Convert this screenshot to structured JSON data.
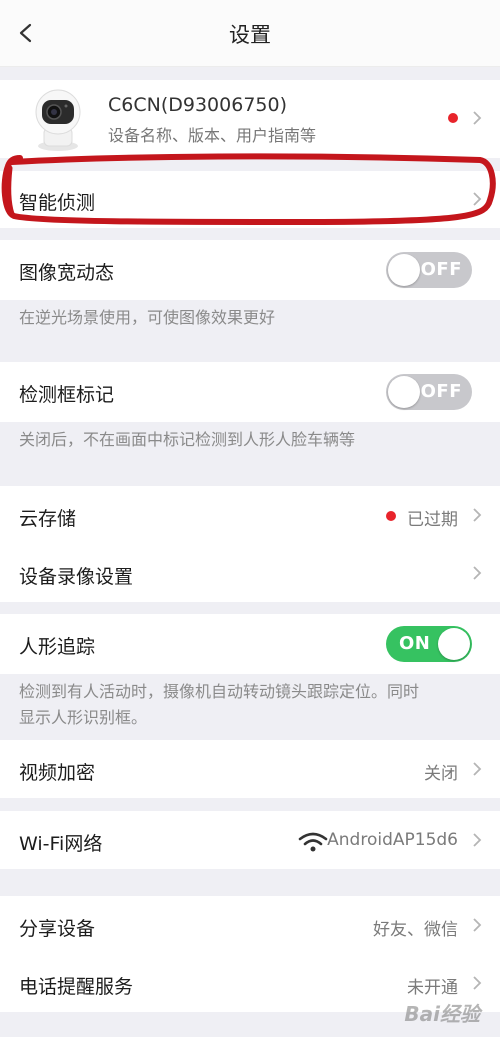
{
  "header": {
    "title": "设置"
  },
  "device": {
    "name": "C6CN(D93006750)",
    "subtitle": "设备名称、版本、用户指南等"
  },
  "smart_detect": {
    "label": "智能侦测"
  },
  "wdr": {
    "label": "图像宽动态",
    "toggle": "OFF",
    "desc": "在逆光场景使用，可使图像效果更好"
  },
  "detect_box": {
    "label": "检测框标记",
    "toggle": "OFF",
    "desc": "关闭后，不在画面中标记检测到人形人脸车辆等"
  },
  "cloud": {
    "label": "云存储",
    "value": "已过期"
  },
  "recording": {
    "label": "设备录像设置"
  },
  "tracking": {
    "label": "人形追踪",
    "toggle": "ON",
    "desc_line1": "检测到有人活动时，摄像机自动转动镜头跟踪定位。同时",
    "desc_line2": "显示人形识别框。"
  },
  "encrypt": {
    "label": "视频加密",
    "value": "关闭"
  },
  "wifi": {
    "label": "Wi-Fi网络",
    "value": "AndroidAP15d6"
  },
  "share": {
    "label": "分享设备",
    "value": "好友、微信"
  },
  "phone_alert": {
    "label": "电话提醒服务",
    "value": "未开通"
  },
  "watermark": "Bai经验",
  "colors": {
    "accent_green": "#36c261",
    "alert_red": "#e8242b",
    "annotation_red": "#c4161c"
  }
}
